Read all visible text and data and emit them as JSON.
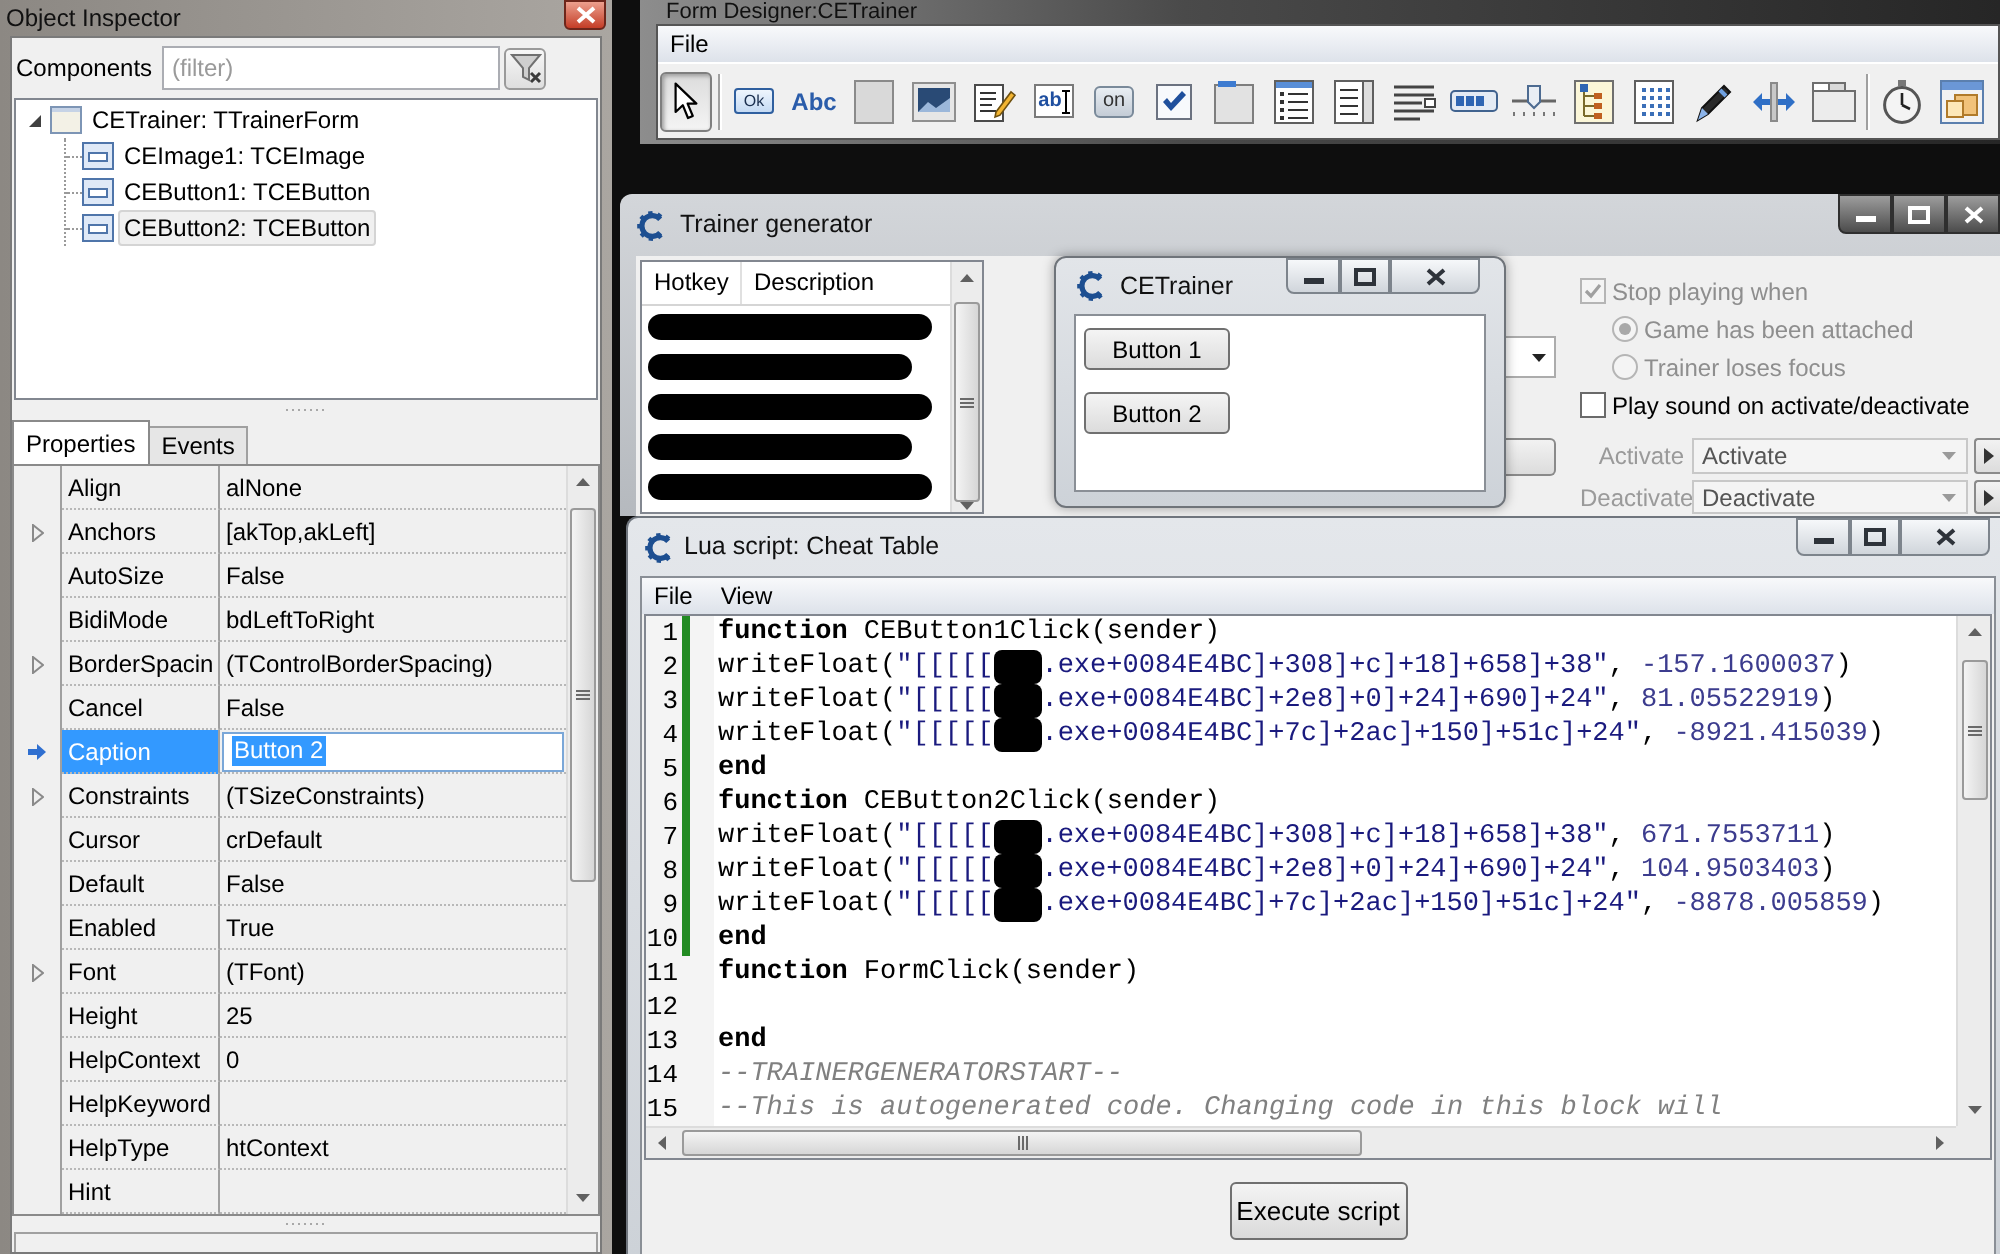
{
  "object_inspector": {
    "title": "Object Inspector",
    "components_label": "Components",
    "filter": {
      "placeholder": "(filter)"
    },
    "tree": [
      {
        "label": "CETrainer: TTrainerForm",
        "kind": "form",
        "expanded": true,
        "selected": false,
        "children": [
          {
            "label": "CEImage1: TCEImage",
            "kind": "component",
            "selected": false
          },
          {
            "label": "CEButton1: TCEButton",
            "kind": "component",
            "selected": false
          },
          {
            "label": "CEButton2: TCEButton",
            "kind": "component",
            "selected": true
          }
        ]
      }
    ],
    "tabs": [
      {
        "label": "Properties",
        "selected": true
      },
      {
        "label": "Events",
        "selected": false
      }
    ],
    "properties": [
      {
        "name": "Align",
        "value": "alNone",
        "expandable": false,
        "selected": false
      },
      {
        "name": "Anchors",
        "value": "[akTop,akLeft]",
        "expandable": true,
        "selected": false
      },
      {
        "name": "AutoSize",
        "value": "False",
        "expandable": false,
        "selected": false
      },
      {
        "name": "BidiMode",
        "value": "bdLeftToRight",
        "expandable": false,
        "selected": false
      },
      {
        "name": "BorderSpacin",
        "value": "(TControlBorderSpacing)",
        "expandable": true,
        "selected": false
      },
      {
        "name": "Cancel",
        "value": "False",
        "expandable": false,
        "selected": false
      },
      {
        "name": "Caption",
        "value": "Button 2",
        "expandable": false,
        "selected": true
      },
      {
        "name": "Constraints",
        "value": "(TSizeConstraints)",
        "expandable": true,
        "selected": false
      },
      {
        "name": "Cursor",
        "value": "crDefault",
        "expandable": false,
        "selected": false
      },
      {
        "name": "Default",
        "value": "False",
        "expandable": false,
        "selected": false
      },
      {
        "name": "Enabled",
        "value": "True",
        "expandable": false,
        "selected": false
      },
      {
        "name": "Font",
        "value": "(TFont)",
        "expandable": true,
        "selected": false
      },
      {
        "name": "Height",
        "value": "25",
        "expandable": false,
        "selected": false
      },
      {
        "name": "HelpContext",
        "value": "0",
        "expandable": false,
        "selected": false
      },
      {
        "name": "HelpKeyword",
        "expandable": false,
        "selected": false
      },
      {
        "name": "HelpType",
        "value": "htContext",
        "expandable": false,
        "selected": false
      },
      {
        "name": "Hint",
        "expandable": false,
        "selected": false
      }
    ]
  },
  "form_designer": {
    "title": "Form Designer:CETrainer",
    "menu": [
      "File"
    ],
    "pointer_tool": {
      "kind": "pointer",
      "selected": true
    },
    "tool_groups": [
      [
        {
          "kind": "button",
          "label": "Ok"
        },
        {
          "kind": "label",
          "label": "Abc"
        },
        {
          "kind": "panel"
        },
        {
          "kind": "image"
        },
        {
          "kind": "memo"
        },
        {
          "kind": "edit",
          "label": "ab"
        },
        {
          "kind": "toggle",
          "label": "on"
        },
        {
          "kind": "checkbox"
        },
        {
          "kind": "page"
        },
        {
          "kind": "listbox"
        },
        {
          "kind": "listpanel"
        },
        {
          "kind": "lines"
        },
        {
          "kind": "progress"
        },
        {
          "kind": "trackbar"
        },
        {
          "kind": "treeview"
        },
        {
          "kind": "grid"
        },
        {
          "kind": "pen"
        },
        {
          "kind": "splitter"
        },
        {
          "kind": "tabs"
        }
      ],
      [
        {
          "kind": "timer"
        },
        {
          "kind": "form"
        }
      ]
    ]
  },
  "trainer_generator": {
    "title": "Trainer generator",
    "hotkey_list": {
      "columns": [
        "Hotkey",
        "Description"
      ],
      "rows": [
        {
          "kind": "redacted"
        },
        {
          "kind": "redacted"
        },
        {
          "kind": "redacted"
        },
        {
          "kind": "redacted"
        },
        {
          "kind": "redacted"
        }
      ]
    },
    "options": [
      {
        "kind": "checkbox",
        "label": "Stop playing when",
        "checked": true,
        "disabled": true
      },
      {
        "kind": "radio",
        "label": "Game has been attached",
        "selected": true,
        "disabled": true
      },
      {
        "kind": "radio",
        "label": "Trainer loses focus",
        "selected": false,
        "disabled": true
      },
      {
        "kind": "checkbox",
        "label": "Play sound on activate/deactivate",
        "checked": false,
        "disabled": false
      }
    ],
    "sounds": [
      {
        "label": "Activate",
        "value": "Activate",
        "disabled": true
      },
      {
        "label": "Deactivate",
        "value": "Deactivate",
        "disabled": true
      }
    ]
  },
  "trainer_preview": {
    "title": "CETrainer",
    "buttons": [
      "Button 1",
      "Button 2"
    ]
  },
  "lua_script": {
    "title": "Lua script: Cheat Table",
    "menu": [
      "File",
      "View"
    ],
    "lines": [
      {
        "number": "1",
        "modified": true,
        "tokens": [
          {
            "kind": "keyword",
            "text": "function"
          },
          {
            "kind": "plain",
            "text": " CEButton1Click(sender)"
          }
        ]
      },
      {
        "number": "2",
        "modified": true,
        "tokens": [
          {
            "kind": "plain",
            "text": "writeFloat("
          },
          {
            "kind": "string",
            "text": "\"[[[[["
          },
          {
            "kind": "redaction"
          },
          {
            "kind": "string",
            "text": ".exe+0084E4BC]+308]+c]+18]+658]+38\""
          },
          {
            "kind": "plain",
            "text": ", "
          },
          {
            "kind": "number",
            "text": "-157.1600037"
          },
          {
            "kind": "plain",
            "text": ")"
          }
        ]
      },
      {
        "number": "3",
        "modified": true,
        "tokens": [
          {
            "kind": "plain",
            "text": "writeFloat("
          },
          {
            "kind": "string",
            "text": "\"[[[[["
          },
          {
            "kind": "redaction"
          },
          {
            "kind": "string",
            "text": ".exe+0084E4BC]+2e8]+0]+24]+690]+24\""
          },
          {
            "kind": "plain",
            "text": ", "
          },
          {
            "kind": "number",
            "text": "81.05522919"
          },
          {
            "kind": "plain",
            "text": ")"
          }
        ]
      },
      {
        "number": "4",
        "modified": true,
        "tokens": [
          {
            "kind": "plain",
            "text": "writeFloat("
          },
          {
            "kind": "string",
            "text": "\"[[[[["
          },
          {
            "kind": "redaction"
          },
          {
            "kind": "string",
            "text": ".exe+0084E4BC]+7c]+2ac]+150]+51c]+24\""
          },
          {
            "kind": "plain",
            "text": ", "
          },
          {
            "kind": "number",
            "text": "-8921.415039"
          },
          {
            "kind": "plain",
            "text": ")"
          }
        ]
      },
      {
        "number": "5",
        "modified": true,
        "tokens": [
          {
            "kind": "keyword",
            "text": "end"
          }
        ]
      },
      {
        "number": "6",
        "modified": true,
        "tokens": [
          {
            "kind": "keyword",
            "text": "function"
          },
          {
            "kind": "plain",
            "text": " CEButton2Click(sender)"
          }
        ]
      },
      {
        "number": "7",
        "modified": true,
        "tokens": [
          {
            "kind": "plain",
            "text": "writeFloat("
          },
          {
            "kind": "string",
            "text": "\"[[[[["
          },
          {
            "kind": "redaction"
          },
          {
            "kind": "string",
            "text": ".exe+0084E4BC]+308]+c]+18]+658]+38\""
          },
          {
            "kind": "plain",
            "text": ", "
          },
          {
            "kind": "number",
            "text": "671.7553711"
          },
          {
            "kind": "plain",
            "text": ")"
          }
        ]
      },
      {
        "number": "8",
        "modified": true,
        "tokens": [
          {
            "kind": "plain",
            "text": "writeFloat("
          },
          {
            "kind": "string",
            "text": "\"[[[[["
          },
          {
            "kind": "redaction"
          },
          {
            "kind": "string",
            "text": ".exe+0084E4BC]+2e8]+0]+24]+690]+24\""
          },
          {
            "kind": "plain",
            "text": ", "
          },
          {
            "kind": "number",
            "text": "104.9503403"
          },
          {
            "kind": "plain",
            "text": ")"
          }
        ]
      },
      {
        "number": "9",
        "modified": true,
        "tokens": [
          {
            "kind": "plain",
            "text": "writeFloat("
          },
          {
            "kind": "string",
            "text": "\"[[[[["
          },
          {
            "kind": "redaction"
          },
          {
            "kind": "string",
            "text": ".exe+0084E4BC]+7c]+2ac]+150]+51c]+24\""
          },
          {
            "kind": "plain",
            "text": ", "
          },
          {
            "kind": "number",
            "text": "-8878.005859"
          },
          {
            "kind": "plain",
            "text": ")"
          }
        ]
      },
      {
        "number": "10",
        "modified": true,
        "tokens": [
          {
            "kind": "keyword",
            "text": "end"
          }
        ]
      },
      {
        "number": "11",
        "modified": false,
        "tokens": [
          {
            "kind": "keyword",
            "text": "function"
          },
          {
            "kind": "plain",
            "text": " FormClick(sender)"
          }
        ]
      },
      {
        "number": "12",
        "modified": false
      },
      {
        "number": "13",
        "modified": false,
        "tokens": [
          {
            "kind": "keyword",
            "text": "end"
          }
        ]
      },
      {
        "number": "14",
        "modified": false,
        "tokens": [
          {
            "kind": "comment",
            "text": "--TRAINERGENERATORSTART--"
          }
        ]
      },
      {
        "number": "15",
        "modified": false,
        "tokens": [
          {
            "kind": "comment",
            "text": "--This is autogenerated code. Changing code in this block will"
          }
        ]
      }
    ],
    "execute_button": "Execute script"
  }
}
